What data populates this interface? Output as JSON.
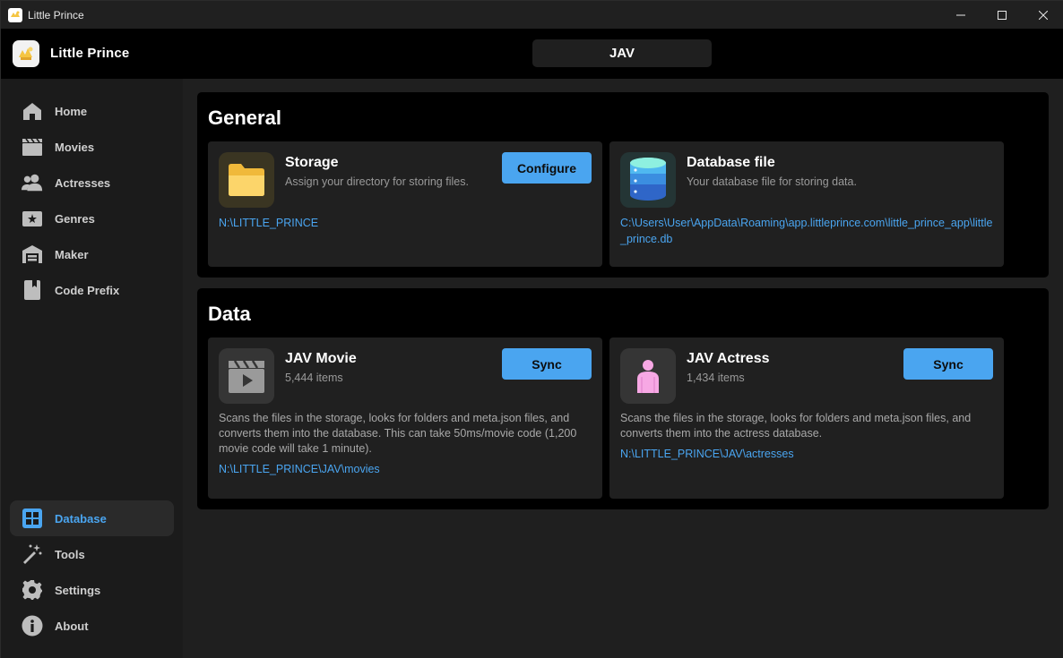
{
  "window": {
    "title": "Little Prince",
    "controls": {
      "minimize": "minimize-icon",
      "maximize": "maximize-icon",
      "close": "close-icon"
    }
  },
  "header": {
    "brand": "Little Prince",
    "active_tab": "JAV"
  },
  "sidebar": {
    "items": [
      {
        "label": "Home",
        "icon": "home-icon"
      },
      {
        "label": "Movies",
        "icon": "clapperboard-icon"
      },
      {
        "label": "Actresses",
        "icon": "users-icon"
      },
      {
        "label": "Genres",
        "icon": "genre-icon"
      },
      {
        "label": "Maker",
        "icon": "warehouse-icon"
      },
      {
        "label": "Code Prefix",
        "icon": "book-icon"
      }
    ],
    "bottom_items": [
      {
        "label": "Database",
        "icon": "grid-icon",
        "active": true
      },
      {
        "label": "Tools",
        "icon": "magic-wand-icon"
      },
      {
        "label": "Settings",
        "icon": "gear-icon"
      },
      {
        "label": "About",
        "icon": "info-icon"
      }
    ]
  },
  "general": {
    "heading": "General",
    "storage": {
      "title": "Storage",
      "subtitle": "Assign your directory for storing files.",
      "button": "Configure",
      "path": "N:\\LITTLE_PRINCE"
    },
    "database_file": {
      "title": "Database file",
      "subtitle": "Your database file for storing data.",
      "path": "C:\\Users\\User\\AppData\\Roaming\\app.littleprince.com\\little_prince_app\\little_prince.db"
    }
  },
  "data": {
    "heading": "Data",
    "movie": {
      "title": "JAV Movie",
      "count": "5,444 items",
      "button": "Sync",
      "description": "Scans the files in the storage, looks for folders and meta.json files, and converts them into the database. This can take 50ms/movie code (1,200 movie code will take 1 minute).",
      "path": "N:\\LITTLE_PRINCE\\JAV\\movies"
    },
    "actress": {
      "title": "JAV Actress",
      "count": "1,434 items",
      "button": "Sync",
      "description": "Scans the files in the storage, looks for folders and meta.json files, and converts them into the actress database.",
      "path": "N:\\LITTLE_PRINCE\\JAV\\actresses"
    }
  },
  "colors": {
    "accent": "#4aa5f0",
    "sidebar_bg": "#1b1b1b",
    "card_bg": "#202020",
    "section_bg": "#000000"
  }
}
